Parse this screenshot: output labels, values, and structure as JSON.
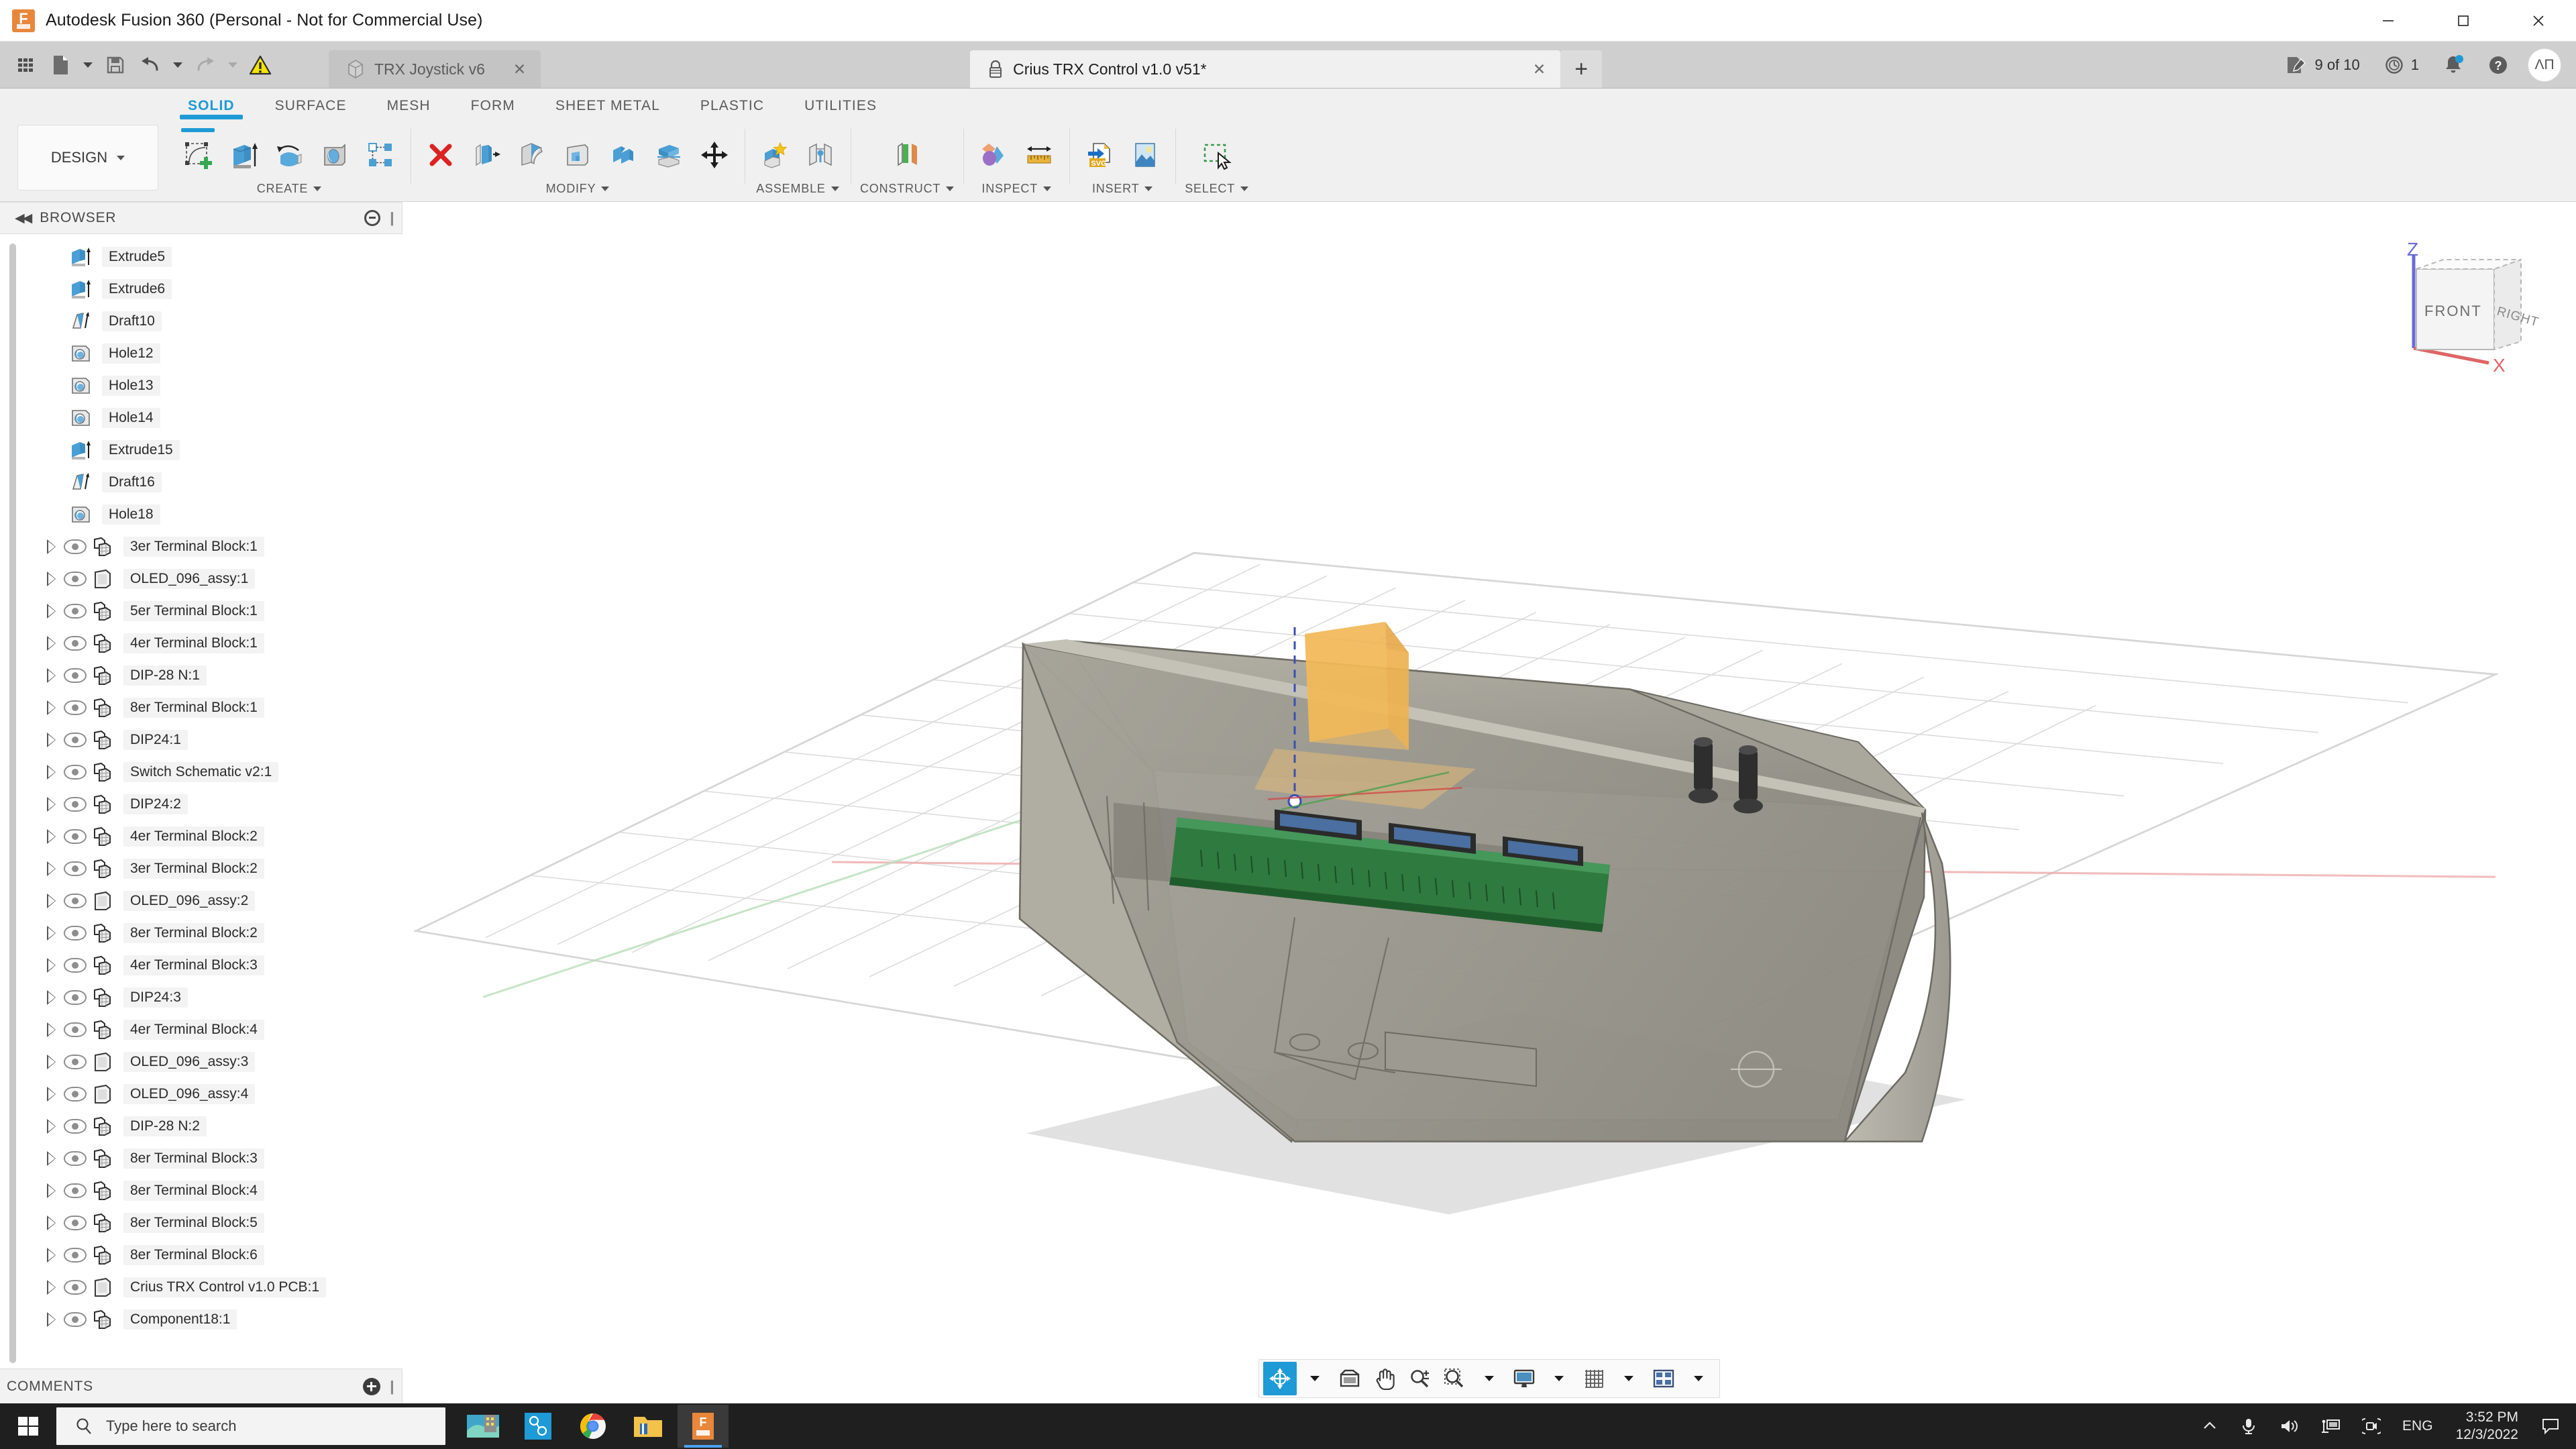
{
  "window": {
    "title": "Autodesk Fusion 360 (Personal - Not for Commercial Use)",
    "minimize": "─",
    "maximize": "☐",
    "close": "✕"
  },
  "quick_access": {
    "items": [
      {
        "name": "show-data-panel-icon",
        "label": "Show Data Panel"
      },
      {
        "name": "file-icon",
        "label": "File"
      },
      {
        "name": "save-icon",
        "label": "Save"
      },
      {
        "name": "undo-icon",
        "label": "Undo"
      },
      {
        "name": "redo-icon",
        "label": "Redo"
      },
      {
        "name": "warning-icon",
        "label": "Warnings"
      }
    ]
  },
  "doc_tabs": [
    {
      "label": "TRX Joystick v6",
      "active": false,
      "icon": "cube-icon",
      "close": "✕"
    },
    {
      "label": "Crius TRX Control v1.0 v51*",
      "active": true,
      "icon": "lock-icon",
      "close": "✕"
    }
  ],
  "new_tab_label": "+",
  "top_right": {
    "edits_label": "9 of 10",
    "history_count": "1",
    "help_label": "?",
    "avatar_initials": "ΛП"
  },
  "ribbon_tabs": [
    {
      "label": "SOLID",
      "active": true
    },
    {
      "label": "SURFACE",
      "active": false
    },
    {
      "label": "MESH",
      "active": false
    },
    {
      "label": "FORM",
      "active": false
    },
    {
      "label": "SHEET METAL",
      "active": false
    },
    {
      "label": "PLASTIC",
      "active": false
    },
    {
      "label": "UTILITIES",
      "active": false
    }
  ],
  "workspace_selector": "DESIGN",
  "ribbon_groups": [
    {
      "label": "CREATE",
      "tools": [
        {
          "name": "create-sketch-icon",
          "label": "Create Sketch"
        },
        {
          "name": "extrude-icon",
          "label": "Extrude"
        },
        {
          "name": "revolve-icon",
          "label": "Revolve"
        },
        {
          "name": "hole-icon",
          "label": "Hole"
        },
        {
          "name": "pattern-icon",
          "label": "Rectangular Pattern"
        }
      ]
    },
    {
      "label": "MODIFY",
      "tools": [
        {
          "name": "press-pull-icon",
          "label": "Press Pull"
        },
        {
          "name": "offset-face-icon",
          "label": "Offset Face"
        },
        {
          "name": "fillet-icon",
          "label": "Fillet"
        },
        {
          "name": "shell-icon",
          "label": "Shell"
        },
        {
          "name": "combine-icon",
          "label": "Combine"
        },
        {
          "name": "split-body-icon",
          "label": "Split Body"
        },
        {
          "name": "move-copy-icon",
          "label": "Move/Copy"
        }
      ]
    },
    {
      "label": "ASSEMBLE",
      "tools": [
        {
          "name": "new-component-icon",
          "label": "New Component"
        },
        {
          "name": "joint-icon",
          "label": "Joint"
        }
      ]
    },
    {
      "label": "CONSTRUCT",
      "tools": [
        {
          "name": "offset-plane-icon",
          "label": "Offset Plane"
        }
      ]
    },
    {
      "label": "INSPECT",
      "tools": [
        {
          "name": "interference-icon",
          "label": "Interference"
        },
        {
          "name": "measure-icon",
          "label": "Measure"
        }
      ]
    },
    {
      "label": "INSERT",
      "tools": [
        {
          "name": "insert-svg-icon",
          "label": "Insert SVG"
        },
        {
          "name": "canvas-image-icon",
          "label": "Canvas"
        }
      ]
    },
    {
      "label": "SELECT",
      "tools": [
        {
          "name": "select-window-icon",
          "label": "Select"
        }
      ]
    }
  ],
  "browser": {
    "title": "BROWSER",
    "collapse_icon": "◀◀",
    "features": [
      {
        "label": "Extrude5",
        "icon": "extrude-feature-icon"
      },
      {
        "label": "Extrude6",
        "icon": "extrude-feature-icon"
      },
      {
        "label": "Draft10",
        "icon": "draft-feature-icon"
      },
      {
        "label": "Hole12",
        "icon": "hole-feature-icon"
      },
      {
        "label": "Hole13",
        "icon": "hole-feature-icon"
      },
      {
        "label": "Hole14",
        "icon": "hole-feature-icon"
      },
      {
        "label": "Extrude15",
        "icon": "extrude-feature-icon"
      },
      {
        "label": "Draft16",
        "icon": "draft-feature-icon"
      },
      {
        "label": "Hole18",
        "icon": "hole-feature-icon"
      }
    ],
    "components": [
      {
        "label": "3er Terminal Block:1",
        "icon": "component-icon"
      },
      {
        "label": "OLED_096_assy:1",
        "icon": "body-icon"
      },
      {
        "label": "5er Terminal Block:1",
        "icon": "component-icon"
      },
      {
        "label": "4er Terminal Block:1",
        "icon": "component-icon"
      },
      {
        "label": "DIP-28 N:1",
        "icon": "component-icon"
      },
      {
        "label": "8er Terminal Block:1",
        "icon": "component-icon"
      },
      {
        "label": "DIP24:1",
        "icon": "component-icon"
      },
      {
        "label": "Switch Schematic v2:1",
        "icon": "component-icon"
      },
      {
        "label": "DIP24:2",
        "icon": "component-icon"
      },
      {
        "label": "4er Terminal Block:2",
        "icon": "component-icon"
      },
      {
        "label": "3er Terminal Block:2",
        "icon": "component-icon"
      },
      {
        "label": "OLED_096_assy:2",
        "icon": "body-icon"
      },
      {
        "label": "8er Terminal Block:2",
        "icon": "component-icon"
      },
      {
        "label": "4er Terminal Block:3",
        "icon": "component-icon"
      },
      {
        "label": "DIP24:3",
        "icon": "component-icon"
      },
      {
        "label": "4er Terminal Block:4",
        "icon": "component-icon"
      },
      {
        "label": "OLED_096_assy:3",
        "icon": "body-icon"
      },
      {
        "label": "OLED_096_assy:4",
        "icon": "body-icon"
      },
      {
        "label": "DIP-28 N:2",
        "icon": "component-icon"
      },
      {
        "label": "8er Terminal Block:3",
        "icon": "component-icon"
      },
      {
        "label": "8er Terminal Block:4",
        "icon": "component-icon"
      },
      {
        "label": "8er Terminal Block:5",
        "icon": "component-icon"
      },
      {
        "label": "8er Terminal Block:6",
        "icon": "component-icon"
      },
      {
        "label": "Crius TRX Control v1.0 PCB:1",
        "icon": "body-icon"
      },
      {
        "label": "Component18:1",
        "icon": "component-icon"
      }
    ]
  },
  "comments": {
    "title": "COMMENTS"
  },
  "viewcube": {
    "front_label": "FRONT",
    "right_label": "RIGHT",
    "z_axis": "Z",
    "x_axis": "X"
  },
  "nav_bar": {
    "items": [
      {
        "name": "orbit-icon",
        "label": "Orbit",
        "active": true,
        "caret": true
      },
      {
        "name": "look-at-icon",
        "label": "Look At",
        "active": false,
        "caret": false
      },
      {
        "name": "pan-icon",
        "label": "Pan",
        "active": false,
        "caret": false
      },
      {
        "name": "zoom-icon",
        "label": "Zoom",
        "active": false,
        "caret": false
      },
      {
        "name": "fit-icon",
        "label": "Fit",
        "active": false,
        "caret": true
      },
      {
        "name": "display-settings-icon",
        "label": "Display Settings",
        "active": false,
        "caret": true
      },
      {
        "name": "grid-snap-icon",
        "label": "Grid and Snaps",
        "active": false,
        "caret": true
      },
      {
        "name": "viewport-layout-icon",
        "label": "Viewports",
        "active": false,
        "caret": true
      }
    ]
  },
  "taskbar": {
    "search_placeholder": "Type here to search",
    "apps": [
      {
        "name": "taskview-icon",
        "label": "Task View"
      },
      {
        "name": "cortana-icon",
        "label": "Cortana"
      },
      {
        "name": "chrome-icon",
        "label": "Google Chrome"
      },
      {
        "name": "file-explorer-icon",
        "label": "File Explorer"
      },
      {
        "name": "fusion360-taskbar-icon",
        "label": "Autodesk Fusion 360"
      }
    ],
    "tray": [
      {
        "name": "show-hidden-icons-icon",
        "label": "^"
      },
      {
        "name": "microphone-icon",
        "label": "Microphone"
      },
      {
        "name": "volume-icon",
        "label": "Volume"
      },
      {
        "name": "network-icon",
        "label": "Network"
      },
      {
        "name": "camera-icon",
        "label": "Camera"
      }
    ],
    "language": "ENG",
    "time": "3:52 PM",
    "date": "12/3/2022",
    "action_center": "Action Center"
  },
  "colors": {
    "accent": "#1e9ad6",
    "ribbon_bg": "#f0f0f0",
    "topbar_bg": "#cfcfcf",
    "taskbar_bg": "#1f1f1f",
    "model_body": "#a9a69c",
    "pcb_green": "#2f7a3e",
    "axis_z": "#6a6ad6",
    "axis_x": "#e06464"
  }
}
